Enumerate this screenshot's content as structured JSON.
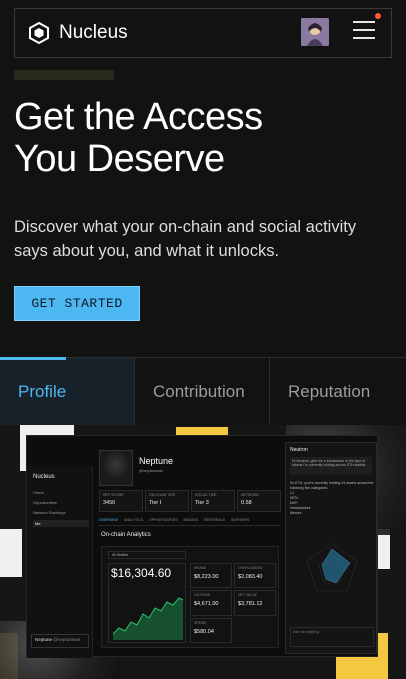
{
  "header": {
    "brand": "Nucleus",
    "logo_icon": "nucleus-cube-icon",
    "menu_icon": "hamburger-menu-icon",
    "notification_color": "#ff5a2b"
  },
  "hero": {
    "title_line1": "Get the Access",
    "title_line2": "You Deserve",
    "subtitle": "Discover what your on-chain and social activity says about you, and what it unlocks.",
    "cta_label": "GET STARTED"
  },
  "tabs": [
    {
      "label": "Profile",
      "active": true
    },
    {
      "label": "Contribution",
      "active": false
    },
    {
      "label": "Reputation",
      "active": false
    }
  ],
  "preview": {
    "sidebar": {
      "logo": "Nucleus",
      "items": [
        "Home",
        "Opportunities",
        "Network Rankings",
        "Me"
      ],
      "user_name": "Neptune",
      "user_handle": "@neptuneain"
    },
    "profile": {
      "name": "Neptune",
      "tag": "@neptuneain",
      "stats": [
        {
          "label": "REP SCORE",
          "value": "3456"
        },
        {
          "label": "ON-CHAIN TIER",
          "value": "Tier I"
        },
        {
          "label": "SOCIAL TIER",
          "value": "Tier 3"
        },
        {
          "label": "NETWORK",
          "value": "0.58"
        }
      ],
      "subnav": [
        "OVERVIEW",
        "ANALYTICS",
        "OPPORTUNITIES",
        "BADGES",
        "REFERRALS",
        "WORKERS"
      ],
      "analytics_title": "On-chain Analytics",
      "wallet_filter": "All Wallets",
      "portfolio_value": "$16,304.60",
      "kpis": [
        {
          "label": "INTAKE",
          "value": "$8,223.00"
        },
        {
          "label": "OVERLOOKED",
          "value": "$2,083.40"
        },
        {
          "label": "OUTTAKE",
          "value": "$4,671.00"
        },
        {
          "label": "NFT VALUE",
          "value": "$3,781.12"
        },
        {
          "label": "SPEND",
          "value": "$580.04"
        }
      ],
      "chart_color": "#27c46b"
    },
    "chat": {
      "title": "Neutron",
      "bubble": "Hi Neutron, give me a breakdown of the type of tokens I'm currently holding across ETH wallets.",
      "answer": "So ETH, you're currently holding 24 assets across the following five categories:",
      "categories": [
        "L1",
        "NFTs",
        "DeFi",
        "Infrastructure",
        "Memes"
      ],
      "input_placeholder": "Ask me anything"
    }
  }
}
